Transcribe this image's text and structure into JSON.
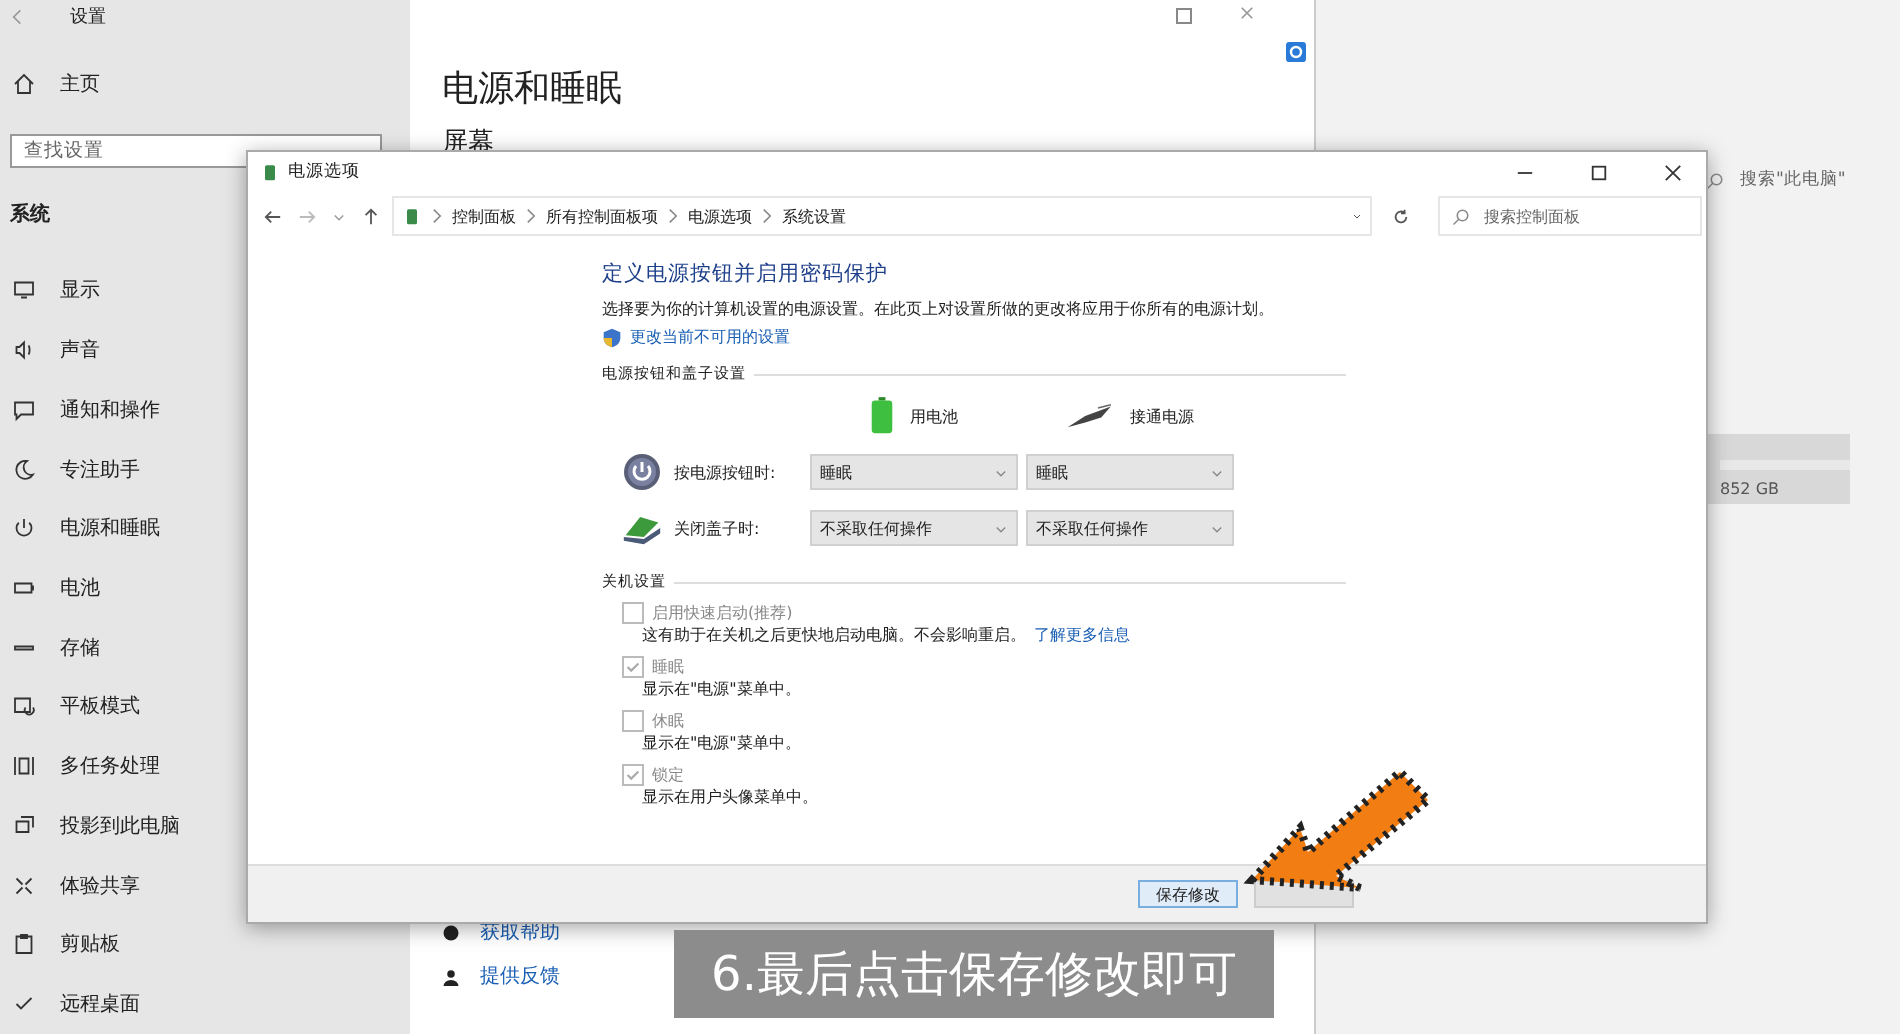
{
  "settings": {
    "title": "设置",
    "home": "主页",
    "search": {
      "placeholder": "查找设置"
    },
    "section": "系统",
    "items": [
      {
        "label": "显示"
      },
      {
        "label": "声音"
      },
      {
        "label": "通知和操作"
      },
      {
        "label": "专注助手"
      },
      {
        "label": "电源和睡眠"
      },
      {
        "label": "电池"
      },
      {
        "label": "存储"
      },
      {
        "label": "平板模式"
      },
      {
        "label": "多任务处理"
      },
      {
        "label": "投影到此电脑"
      },
      {
        "label": "体验共享"
      },
      {
        "label": "剪贴板"
      },
      {
        "label": "远程桌面"
      }
    ],
    "page_title": "电源和睡眠",
    "page_subtitle": "屏幕",
    "links": [
      "获取帮助",
      "提供反馈"
    ]
  },
  "explorer": {
    "search": {
      "placeholder": "搜索\"此电脑\""
    },
    "disk_text": "852 GB"
  },
  "dialog": {
    "title": "电源选项",
    "breadcrumb": [
      "控制面板",
      "所有控制面板项",
      "电源选项",
      "系统设置"
    ],
    "search": {
      "placeholder": "搜索控制面板"
    },
    "heading": "定义电源按钮并启用密码保护",
    "description": "选择要为你的计算机设置的电源设置。在此页上对设置所做的更改将应用于你所有的电源计划。",
    "admin_link": "更改当前不可用的设置",
    "group1": "电源按钮和盖子设置",
    "columns": [
      "用电池",
      "接通电源"
    ],
    "rows": [
      {
        "kind": "power",
        "label": "按电源按钮时:",
        "values": [
          "睡眠",
          "睡眠"
        ]
      },
      {
        "kind": "lid",
        "label": "关闭盖子时:",
        "values": [
          "不采取任何操作",
          "不采取任何操作"
        ]
      }
    ],
    "group2": "关机设置",
    "options": [
      {
        "label": "启用快速启动(推荐)",
        "checked": false,
        "disabled": true,
        "description": "这有助于在关机之后更快地启动电脑。不会影响重启。",
        "link": "了解更多信息"
      },
      {
        "label": "睡眠",
        "checked": true,
        "disabled": true,
        "description": "显示在\"电源\"菜单中。"
      },
      {
        "label": "休眠",
        "checked": false,
        "disabled": true,
        "description": "显示在\"电源\"菜单中。"
      },
      {
        "label": "锁定",
        "checked": true,
        "disabled": true,
        "description": "显示在用户头像菜单中。"
      }
    ],
    "save_button": "保存修改"
  },
  "caption": "6.最后点击保存修改即可"
}
